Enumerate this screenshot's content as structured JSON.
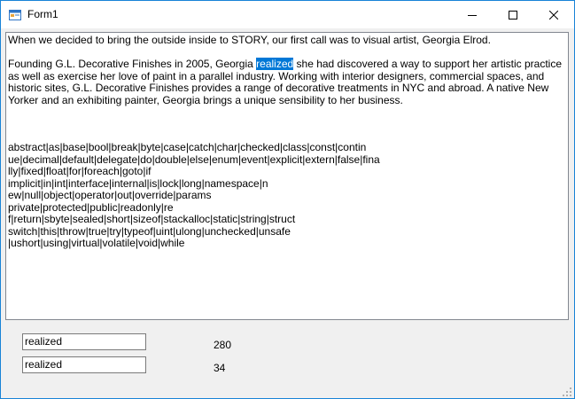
{
  "window": {
    "title": "Form1",
    "controls": {
      "minimize": "minimize-icon",
      "maximize": "maximize-icon",
      "close": "close-icon"
    }
  },
  "editor": {
    "line1": "When we decided to bring the outside inside to STORY, our first call was to visual artist, Georgia Elrod.",
    "para2_before": "Founding G.L. Decorative Finishes in 2005, Georgia ",
    "para2_highlight": "realized",
    "para2_after": " she had discovered a way to support her artistic practice as well as exercise her love of paint in a parallel industry. Working with interior designers, commercial spaces, and historic sites, G.L. Decorative Finishes provides a range of decorative treatments in NYC and abroad. A native New Yorker and an exhibiting painter, Georgia brings a unique sensibility to her business.",
    "keywords": [
      "abstract|as|base|bool|break|byte|case|catch|char|checked|class|const|contin",
      "ue|decimal|default|delegate|do|double|else|enum|event|explicit|extern|false|fina",
      "lly|fixed|float|for|foreach|goto|if",
      "implicit|in|int|interface|internal|is|lock|long|namespace|n",
      "ew|null|object|operator|out|override|params",
      "private|protected|public|readonly|re",
      "f|return|sbyte|sealed|short|sizeof|stackalloc|static|string|struct",
      "switch|this|throw|true|try|typeof|uint|ulong|unchecked|unsafe",
      "|ushort|using|virtual|volatile|void|while"
    ]
  },
  "fields": {
    "field1_value": "realized",
    "field2_value": "realized"
  },
  "numbers": {
    "value1": "280",
    "value2": "34"
  },
  "colors": {
    "accent_border": "#1883d7",
    "selection": "#0078d7"
  }
}
